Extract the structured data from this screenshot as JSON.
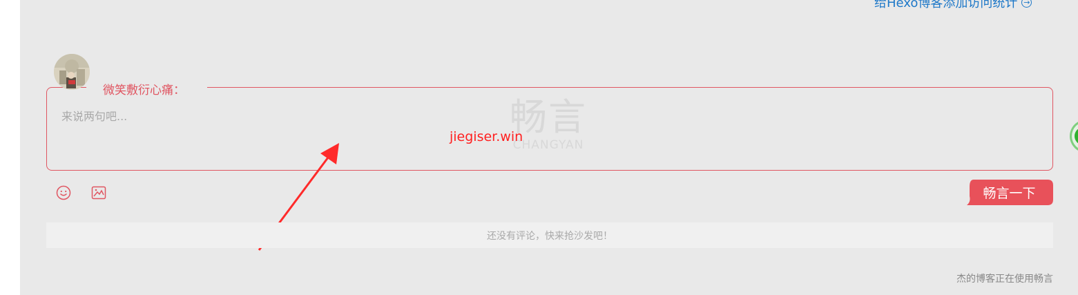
{
  "header": {
    "link_text": "给Hexo博客添加访问统计",
    "link_icon": "arrow-circle-right-icon"
  },
  "comment_form": {
    "username": "微笑敷衍心痛：",
    "placeholder": "来说两句吧...",
    "watermark_cn": "畅言",
    "watermark_en": "CHANGYAN",
    "submit_label": "畅言一下",
    "emoji_icon": "emoji-icon",
    "image_icon": "image-icon"
  },
  "annotation": {
    "text": "jiegiser.win"
  },
  "comments": {
    "empty_text": "还没有评论，快来抢沙发吧！"
  },
  "footer": {
    "powered_text": "杰的博客正在使用畅言"
  },
  "colors": {
    "accent": "#e05561",
    "link": "#1e78c8",
    "panel_bg": "#e9e9e9"
  }
}
